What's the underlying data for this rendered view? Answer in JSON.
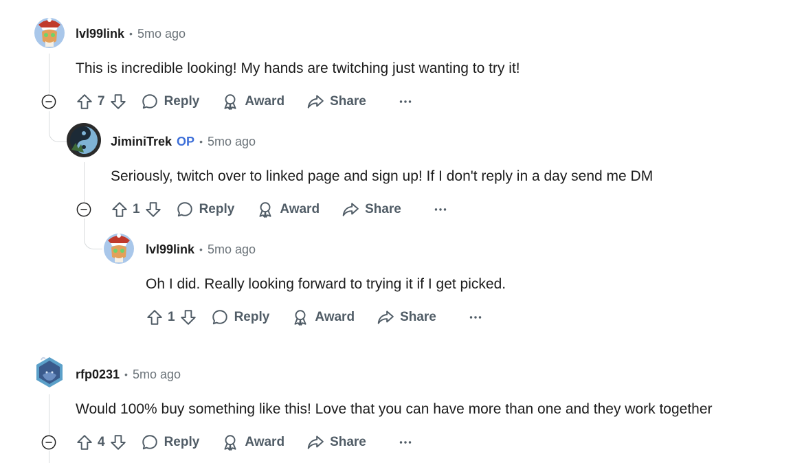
{
  "comments": [
    {
      "username": "lvl99link",
      "time": "5mo ago",
      "body": "This is incredible looking! My hands are twitching just wanting to try it!",
      "votes": "7",
      "reply_label": "Reply",
      "award_label": "Award",
      "share_label": "Share",
      "more_label": "···"
    },
    {
      "username": "JiminiTrek",
      "op_badge": "OP",
      "time": "5mo ago",
      "body": "Seriously, twitch over to linked page and sign up! If I don't reply in a day send me DM",
      "votes": "1",
      "reply_label": "Reply",
      "award_label": "Award",
      "share_label": "Share",
      "more_label": "···"
    },
    {
      "username": "lvl99link",
      "time": "5mo ago",
      "body": "Oh I did. Really looking forward to trying it if I get picked.",
      "votes": "1",
      "reply_label": "Reply",
      "award_label": "Award",
      "share_label": "Share",
      "more_label": "···"
    },
    {
      "username": "rfp0231",
      "time": "5mo ago",
      "body": "Would 100% buy something like this! Love that you can have more than one and they work together",
      "votes": "4",
      "reply_label": "Reply",
      "award_label": "Award",
      "share_label": "Share",
      "more_label": "···"
    }
  ],
  "separator": "•",
  "colors": {
    "op": "#3d6fd8",
    "meta": "#6b7379",
    "actions": "#505c66",
    "thread_line": "#d7dadc"
  },
  "icons": [
    "upvote-icon",
    "downvote-icon",
    "reply-bubble-icon",
    "award-icon",
    "share-arrow-icon",
    "collapse-minus-icon",
    "overflow-dots-icon"
  ]
}
